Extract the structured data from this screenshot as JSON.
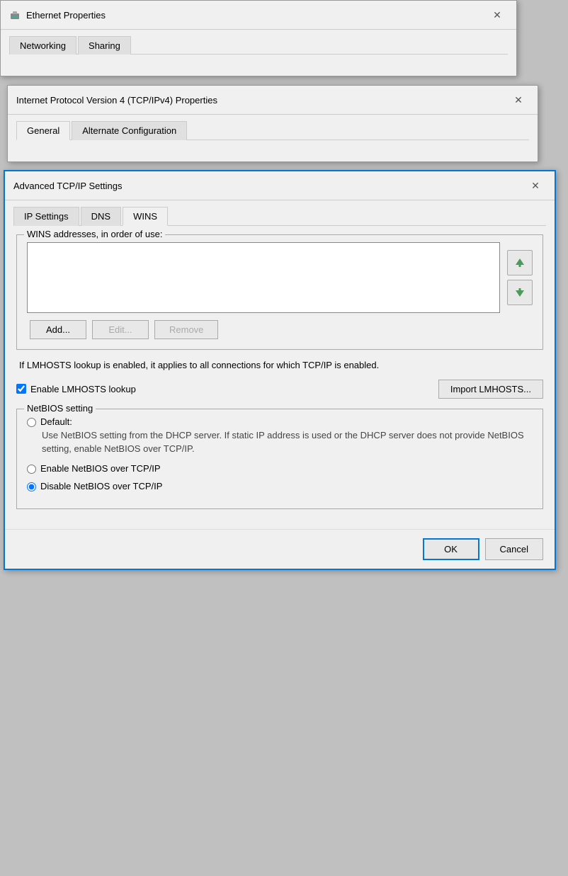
{
  "ethernet_window": {
    "title": "Ethernet Properties",
    "tabs": [
      "Networking",
      "Sharing"
    ],
    "active_tab": "Networking"
  },
  "ipv4_window": {
    "title": "Internet Protocol Version 4 (TCP/IPv4) Properties",
    "tabs": [
      "General",
      "Alternate Configuration"
    ],
    "active_tab": "General"
  },
  "advanced_window": {
    "title": "Advanced TCP/IP Settings",
    "tabs": [
      "IP Settings",
      "DNS",
      "WINS"
    ],
    "active_tab": "WINS",
    "wins_section": {
      "label": "WINS addresses, in order of use:",
      "add_btn": "Add...",
      "edit_btn": "Edit...",
      "remove_btn": "Remove",
      "info_text": "If LMHOSTS lookup is enabled, it applies to all connections for which TCP/IP is enabled.",
      "enable_lmhosts_label": "Enable LMHOSTS lookup",
      "import_btn": "Import LMHOSTS...",
      "netbios_label": "NetBIOS setting",
      "default_label": "Default:",
      "default_desc": "Use NetBIOS setting from the DHCP server. If static IP address is used or the DHCP server does not provide NetBIOS setting, enable NetBIOS over TCP/IP.",
      "enable_netbios_label": "Enable NetBIOS over TCP/IP",
      "disable_netbios_label": "Disable NetBIOS over TCP/IP"
    },
    "ok_btn": "OK",
    "cancel_btn": "Cancel"
  }
}
